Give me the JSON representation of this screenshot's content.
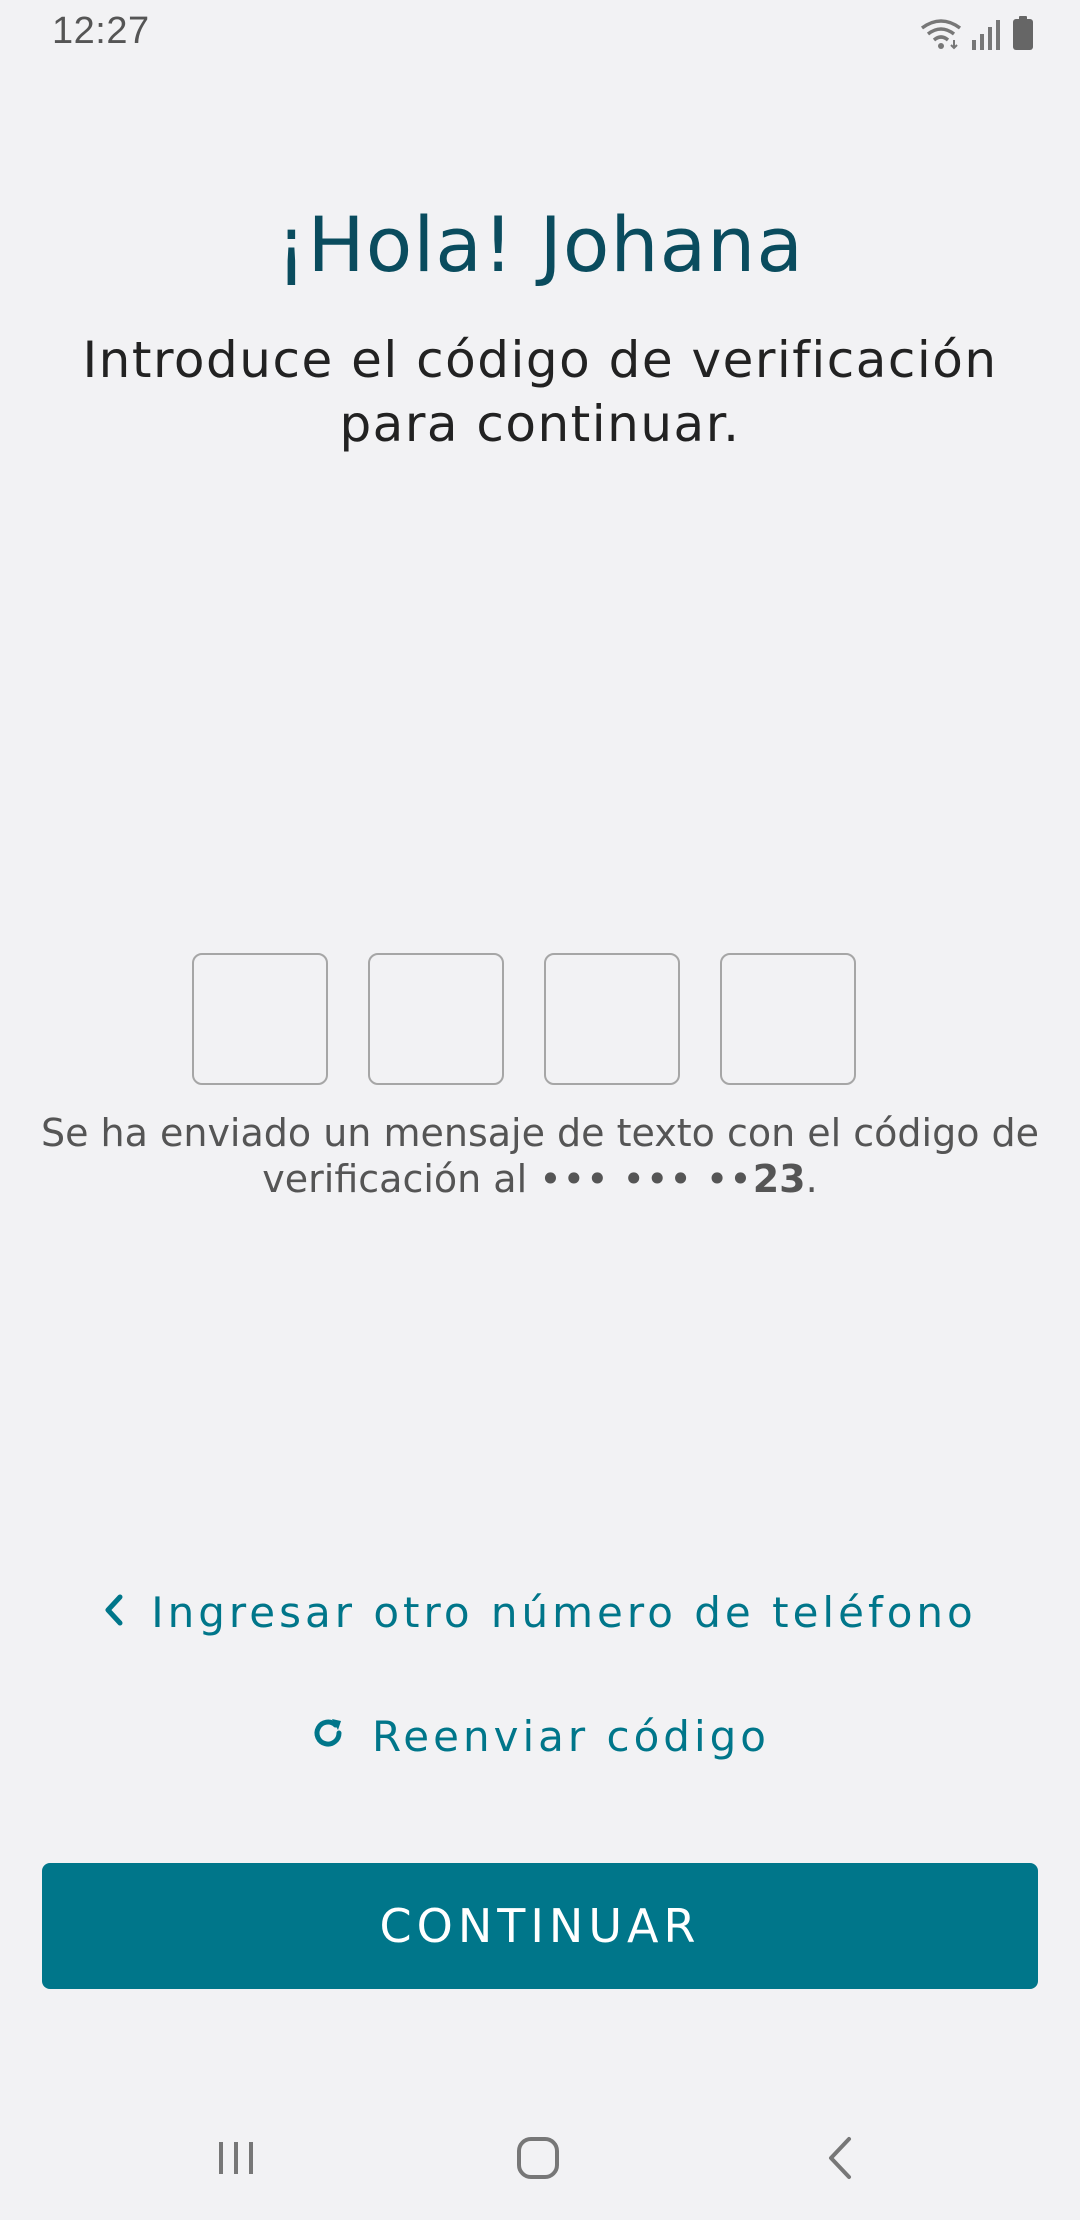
{
  "status_bar": {
    "time": "12:27",
    "icons": [
      "wifi-icon",
      "signal-icon",
      "battery-icon"
    ]
  },
  "header": {
    "greeting": "¡Hola! Johana",
    "instructions": "Introduce el código de verificación para continuar."
  },
  "code_input": {
    "length": 4,
    "digits": [
      "",
      "",
      "",
      ""
    ]
  },
  "message": {
    "prefix": "Se ha enviado un mensaje de texto con el código de verificación al ",
    "masked_number": "••• ••• ••",
    "last_digits": "23",
    "suffix": "."
  },
  "links": {
    "other_number": "Ingresar otro número de teléfono",
    "other_number_icon": "chevron-left-icon",
    "resend": "Reenviar código",
    "resend_icon": "refresh-icon"
  },
  "primary_button": {
    "label": "CONTINUAR"
  },
  "colors": {
    "background": "#f2f2f4",
    "accent": "#00768a",
    "title": "#0a4c5e",
    "box_border": "#a6a6a6"
  },
  "nav_bar": {
    "icons": [
      "recents-icon",
      "home-icon",
      "back-icon"
    ]
  }
}
